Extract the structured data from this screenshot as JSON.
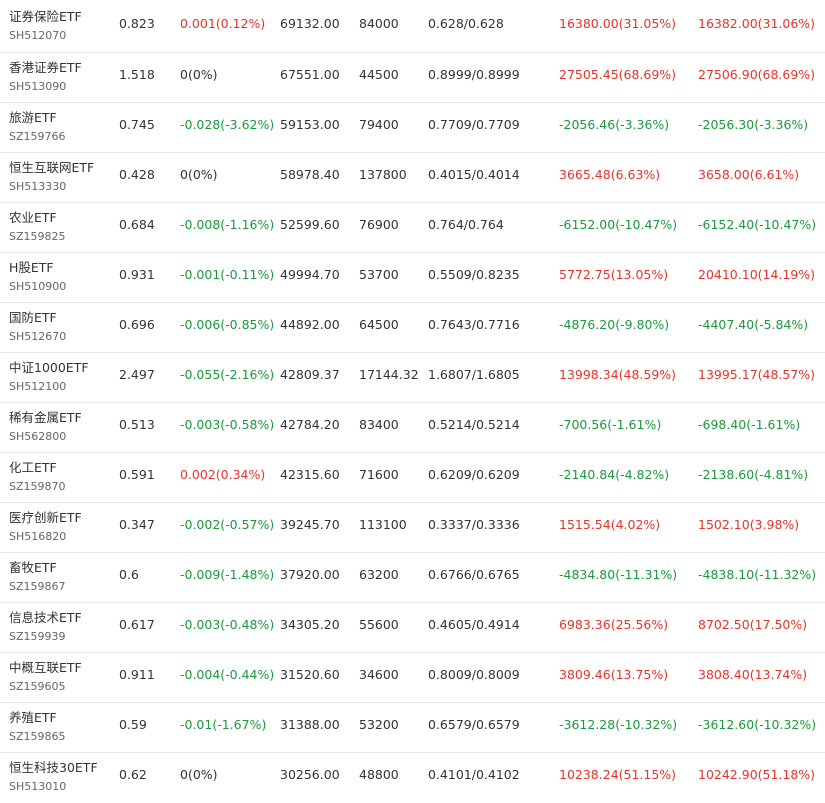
{
  "colors": {
    "up": "#e5342a",
    "down": "#1a9a3c",
    "flat": "#333333",
    "divider": "#e8e8e8"
  },
  "rows": [
    {
      "name": "证券保险ETF",
      "code": "SH512070",
      "price": "0.823",
      "change": "0.001(0.12%)",
      "change_dir": "up",
      "value": "69132.00",
      "shares": "84000",
      "cost": "0.628/0.628",
      "pnl1": "16380.00(31.05%)",
      "pnl1_dir": "up",
      "pnl2": "16382.00(31.06%)",
      "pnl2_dir": "up"
    },
    {
      "name": "香港证券ETF",
      "code": "SH513090",
      "price": "1.518",
      "change": "0(0%)",
      "change_dir": "flat",
      "value": "67551.00",
      "shares": "44500",
      "cost": "0.8999/0.8999",
      "pnl1": "27505.45(68.69%)",
      "pnl1_dir": "up",
      "pnl2": "27506.90(68.69%)",
      "pnl2_dir": "up"
    },
    {
      "name": "旅游ETF",
      "code": "SZ159766",
      "price": "0.745",
      "change": "-0.028(-3.62%)",
      "change_dir": "down",
      "value": "59153.00",
      "shares": "79400",
      "cost": "0.7709/0.7709",
      "pnl1": "-2056.46(-3.36%)",
      "pnl1_dir": "down",
      "pnl2": "-2056.30(-3.36%)",
      "pnl2_dir": "down"
    },
    {
      "name": "恒生互联网ETF",
      "code": "SH513330",
      "price": "0.428",
      "change": "0(0%)",
      "change_dir": "flat",
      "value": "58978.40",
      "shares": "137800",
      "cost": "0.4015/0.4014",
      "pnl1": "3665.48(6.63%)",
      "pnl1_dir": "up",
      "pnl2": "3658.00(6.61%)",
      "pnl2_dir": "up"
    },
    {
      "name": "农业ETF",
      "code": "SZ159825",
      "price": "0.684",
      "change": "-0.008(-1.16%)",
      "change_dir": "down",
      "value": "52599.60",
      "shares": "76900",
      "cost": "0.764/0.764",
      "pnl1": "-6152.00(-10.47%)",
      "pnl1_dir": "down",
      "pnl2": "-6152.40(-10.47%)",
      "pnl2_dir": "down"
    },
    {
      "name": "H股ETF",
      "code": "SH510900",
      "price": "0.931",
      "change": "-0.001(-0.11%)",
      "change_dir": "down",
      "value": "49994.70",
      "shares": "53700",
      "cost": "0.5509/0.8235",
      "pnl1": "5772.75(13.05%)",
      "pnl1_dir": "up",
      "pnl2": "20410.10(14.19%)",
      "pnl2_dir": "up"
    },
    {
      "name": "国防ETF",
      "code": "SH512670",
      "price": "0.696",
      "change": "-0.006(-0.85%)",
      "change_dir": "down",
      "value": "44892.00",
      "shares": "64500",
      "cost": "0.7643/0.7716",
      "pnl1": "-4876.20(-9.80%)",
      "pnl1_dir": "down",
      "pnl2": "-4407.40(-5.84%)",
      "pnl2_dir": "down"
    },
    {
      "name": "中证1000ETF",
      "code": "SH512100",
      "price": "2.497",
      "change": "-0.055(-2.16%)",
      "change_dir": "down",
      "value": "42809.37",
      "shares": "17144.32",
      "cost": "1.6807/1.6805",
      "pnl1": "13998.34(48.59%)",
      "pnl1_dir": "up",
      "pnl2": "13995.17(48.57%)",
      "pnl2_dir": "up"
    },
    {
      "name": "稀有金属ETF",
      "code": "SH562800",
      "price": "0.513",
      "change": "-0.003(-0.58%)",
      "change_dir": "down",
      "value": "42784.20",
      "shares": "83400",
      "cost": "0.5214/0.5214",
      "pnl1": "-700.56(-1.61%)",
      "pnl1_dir": "down",
      "pnl2": "-698.40(-1.61%)",
      "pnl2_dir": "down"
    },
    {
      "name": "化工ETF",
      "code": "SZ159870",
      "price": "0.591",
      "change": "0.002(0.34%)",
      "change_dir": "up",
      "value": "42315.60",
      "shares": "71600",
      "cost": "0.6209/0.6209",
      "pnl1": "-2140.84(-4.82%)",
      "pnl1_dir": "down",
      "pnl2": "-2138.60(-4.81%)",
      "pnl2_dir": "down"
    },
    {
      "name": "医疗创新ETF",
      "code": "SH516820",
      "price": "0.347",
      "change": "-0.002(-0.57%)",
      "change_dir": "down",
      "value": "39245.70",
      "shares": "113100",
      "cost": "0.3337/0.3336",
      "pnl1": "1515.54(4.02%)",
      "pnl1_dir": "up",
      "pnl2": "1502.10(3.98%)",
      "pnl2_dir": "up"
    },
    {
      "name": "畜牧ETF",
      "code": "SZ159867",
      "price": "0.6",
      "change": "-0.009(-1.48%)",
      "change_dir": "down",
      "value": "37920.00",
      "shares": "63200",
      "cost": "0.6766/0.6765",
      "pnl1": "-4834.80(-11.31%)",
      "pnl1_dir": "down",
      "pnl2": "-4838.10(-11.32%)",
      "pnl2_dir": "down"
    },
    {
      "name": "信息技术ETF",
      "code": "SZ159939",
      "price": "0.617",
      "change": "-0.003(-0.48%)",
      "change_dir": "down",
      "value": "34305.20",
      "shares": "55600",
      "cost": "0.4605/0.4914",
      "pnl1": "6983.36(25.56%)",
      "pnl1_dir": "up",
      "pnl2": "8702.50(17.50%)",
      "pnl2_dir": "up"
    },
    {
      "name": "中概互联ETF",
      "code": "SZ159605",
      "price": "0.911",
      "change": "-0.004(-0.44%)",
      "change_dir": "down",
      "value": "31520.60",
      "shares": "34600",
      "cost": "0.8009/0.8009",
      "pnl1": "3809.46(13.75%)",
      "pnl1_dir": "up",
      "pnl2": "3808.40(13.74%)",
      "pnl2_dir": "up"
    },
    {
      "name": "养殖ETF",
      "code": "SZ159865",
      "price": "0.59",
      "change": "-0.01(-1.67%)",
      "change_dir": "down",
      "value": "31388.00",
      "shares": "53200",
      "cost": "0.6579/0.6579",
      "pnl1": "-3612.28(-10.32%)",
      "pnl1_dir": "down",
      "pnl2": "-3612.60(-10.32%)",
      "pnl2_dir": "down"
    },
    {
      "name": "恒生科技30ETF",
      "code": "SH513010",
      "price": "0.62",
      "change": "0(0%)",
      "change_dir": "flat",
      "value": "30256.00",
      "shares": "48800",
      "cost": "0.4101/0.4102",
      "pnl1": "10238.24(51.15%)",
      "pnl1_dir": "up",
      "pnl2": "10242.90(51.18%)",
      "pnl2_dir": "up"
    }
  ]
}
